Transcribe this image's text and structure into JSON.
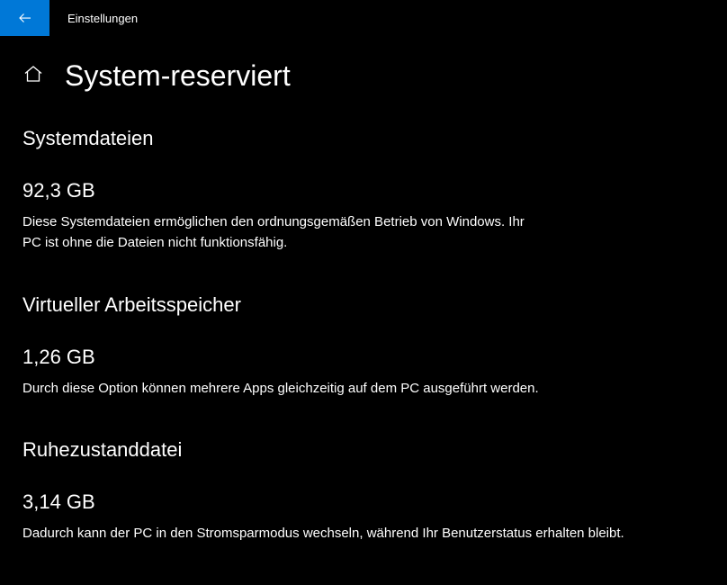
{
  "titlebar": {
    "app_title": "Einstellungen"
  },
  "header": {
    "page_title": "System-reserviert"
  },
  "sections": [
    {
      "heading": "Systemdateien",
      "value": "92,3 GB",
      "description": "Diese Systemdateien ermöglichen den ordnungsgemäßen Betrieb von Windows. Ihr PC ist ohne die Dateien nicht funktionsfähig."
    },
    {
      "heading": "Virtueller Arbeitsspeicher",
      "value": "1,26 GB",
      "description": "Durch diese Option können mehrere Apps gleichzeitig auf dem PC ausgeführt werden."
    },
    {
      "heading": "Ruhezustanddatei",
      "value": "3,14 GB",
      "description": "Dadurch kann der PC in den Stromsparmodus wechseln, während Ihr Benutzerstatus erhalten bleibt."
    }
  ]
}
